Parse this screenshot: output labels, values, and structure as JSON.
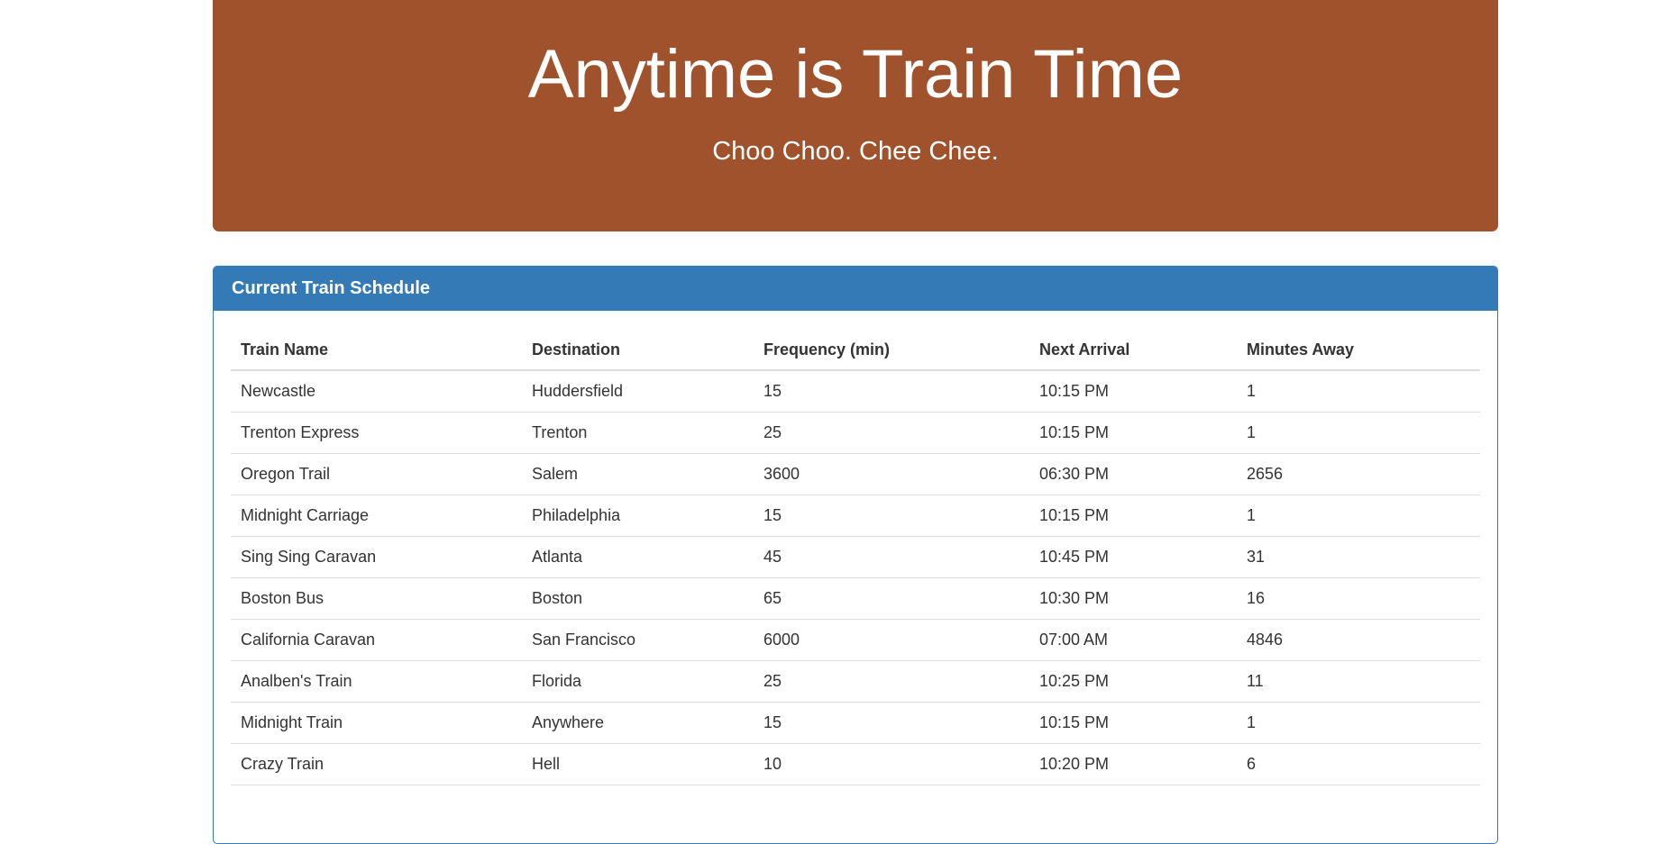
{
  "header": {
    "title": "Anytime is Train Time",
    "subtitle": "Choo Choo. Chee Chee."
  },
  "panel": {
    "title": "Current Train Schedule"
  },
  "table": {
    "columns": [
      "Train Name",
      "Destination",
      "Frequency (min)",
      "Next Arrival",
      "Minutes Away"
    ],
    "rows": [
      [
        "Newcastle",
        "Huddersfield",
        "15",
        "10:15 PM",
        "1"
      ],
      [
        "Trenton Express",
        "Trenton",
        "25",
        "10:15 PM",
        "1"
      ],
      [
        "Oregon Trail",
        "Salem",
        "3600",
        "06:30 PM",
        "2656"
      ],
      [
        "Midnight Carriage",
        "Philadelphia",
        "15",
        "10:15 PM",
        "1"
      ],
      [
        "Sing Sing Caravan",
        "Atlanta",
        "45",
        "10:45 PM",
        "31"
      ],
      [
        "Boston Bus",
        "Boston",
        "65",
        "10:30 PM",
        "16"
      ],
      [
        "California Caravan",
        "San Francisco",
        "6000",
        "07:00 AM",
        "4846"
      ],
      [
        "Analben's Train",
        "Florida",
        "25",
        "10:25 PM",
        "11"
      ],
      [
        "Midnight Train",
        "Anywhere",
        "15",
        "10:15 PM",
        "1"
      ],
      [
        "Crazy Train",
        "Hell",
        "10",
        "10:20 PM",
        "6"
      ]
    ]
  },
  "colors": {
    "jumbotron_bg": "#a0522d",
    "panel_primary": "#337ab7"
  }
}
